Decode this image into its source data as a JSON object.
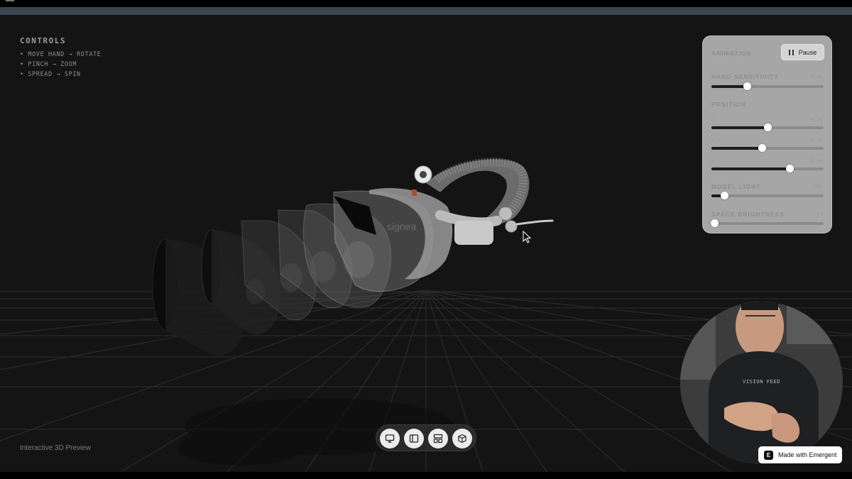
{
  "controls": {
    "title": "CONTROLS",
    "items": [
      "• MOVE HAND → ROTATE",
      "• PINCH → ZOOM",
      "• SPREAD → SPIN"
    ]
  },
  "panel": {
    "animation_label": "ANIMATION",
    "pause_label": "Pause",
    "hand_sensitivity": {
      "label": "HAND SENSITIVITY",
      "value_text": "1.0x",
      "level": 0.32
    },
    "position_label": "POSITION",
    "position": [
      {
        "axis": "X",
        "value_text": "0.00",
        "level": 0.5
      },
      {
        "axis": "Y",
        "value_text": "-0.20",
        "level": 0.45
      },
      {
        "axis": "Z",
        "value_text": "0.00",
        "level": 0.7
      }
    ],
    "model_light": {
      "label": "MODEL LIGHT",
      "value_text": "20%",
      "level": 0.12
    },
    "space_brightness": {
      "label": "SPACE BRIGHTNESS",
      "value_text": "0%",
      "level": 0.03
    }
  },
  "camera": {
    "label": "VISION FEED"
  },
  "badge": {
    "label": "Made with Emergent",
    "logo_letter": "E"
  },
  "footer": {
    "preview_label": "Interactive 3D Preview"
  },
  "toolbar": {
    "icons": [
      "monitor-icon",
      "sidebar-layout-icon",
      "grid-layout-icon",
      "cube-icon"
    ]
  },
  "model": {
    "label": "Apple Vision Pro exploded view",
    "brand_text": "signea"
  },
  "colors": {
    "background": "#141414",
    "panel": "#a6a6a6",
    "accent_bar": "#3a4652"
  }
}
